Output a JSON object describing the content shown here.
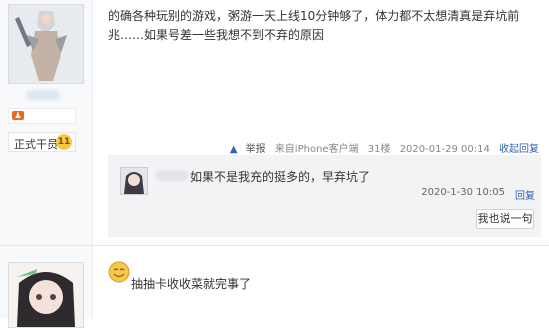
{
  "post1": {
    "text": "的确各种玩别的游戏，粥游一天上线10分钟够了，体力都不太想清真是弃坑前兆……如果号差一些我想不到不弃的原因",
    "user_rank_label": "正式干员",
    "user_level": "11",
    "meta": {
      "report_label": "举报",
      "source": "来自iPhone客户端",
      "floor": "31楼",
      "time": "2020-01-29 00:14",
      "collapse_label": "收起回复"
    }
  },
  "reply": {
    "text": "如果不是我充的挺多的，早弃坑了",
    "time": "2020-1-30 10:05",
    "reply_link": "回复",
    "reply_button": "我也说一句"
  },
  "post2": {
    "text": "抽抽卡收收菜就完事了"
  },
  "colors": {
    "link": "#2d64b3",
    "badge": "#f5c745",
    "level_icon": "#e86a1c",
    "reply_bg": "#f2f3f5"
  }
}
